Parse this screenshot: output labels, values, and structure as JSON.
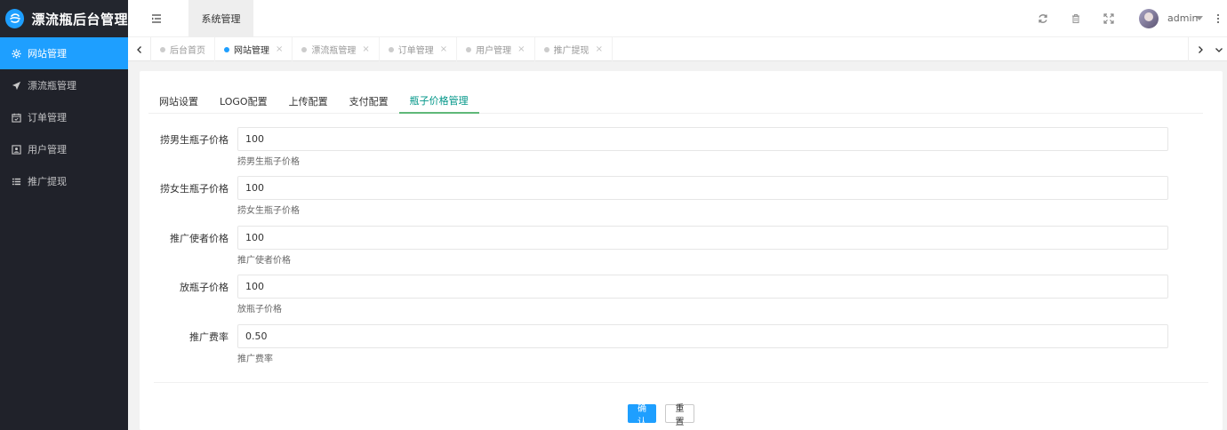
{
  "app": {
    "title": "漂流瓶后台管理"
  },
  "sidebar": {
    "items": [
      {
        "label": "网站管理",
        "icon": "gear-icon",
        "active": true
      },
      {
        "label": "漂流瓶管理",
        "icon": "paper-plane-icon",
        "active": false
      },
      {
        "label": "订单管理",
        "icon": "calendar-icon",
        "active": false
      },
      {
        "label": "用户管理",
        "icon": "user-card-icon",
        "active": false
      },
      {
        "label": "推广提现",
        "icon": "list-icon",
        "active": false
      }
    ]
  },
  "header": {
    "system_tab": "系统管理",
    "username": "admin"
  },
  "tabbar": {
    "tabs": [
      {
        "label": "后台首页",
        "closable": false,
        "active": false
      },
      {
        "label": "网站管理",
        "closable": true,
        "active": true
      },
      {
        "label": "漂流瓶管理",
        "closable": true,
        "active": false
      },
      {
        "label": "订单管理",
        "closable": true,
        "active": false
      },
      {
        "label": "用户管理",
        "closable": true,
        "active": false
      },
      {
        "label": "推广提现",
        "closable": true,
        "active": false
      }
    ],
    "close_glyph": "×"
  },
  "settings": {
    "tabs": [
      {
        "label": "网站设置",
        "active": false
      },
      {
        "label": "LOGO配置",
        "active": false
      },
      {
        "label": "上传配置",
        "active": false
      },
      {
        "label": "支付配置",
        "active": false
      },
      {
        "label": "瓶子价格管理",
        "active": true
      }
    ],
    "fields": [
      {
        "label": "捞男生瓶子价格",
        "value": "100",
        "help": "捞男生瓶子价格"
      },
      {
        "label": "捞女生瓶子价格",
        "value": "100",
        "help": "捞女生瓶子价格"
      },
      {
        "label": "推广使者价格",
        "value": "100",
        "help": "推广使者价格"
      },
      {
        "label": "放瓶子价格",
        "value": "100",
        "help": "放瓶子价格"
      },
      {
        "label": "推广费率",
        "value": "0.50",
        "help": "推广费率"
      }
    ],
    "confirm_label": "确认",
    "reset_label": "重置"
  },
  "colors": {
    "sidebar_bg": "#20222a",
    "accent": "#1e9fff",
    "tab_active": "#009688"
  }
}
